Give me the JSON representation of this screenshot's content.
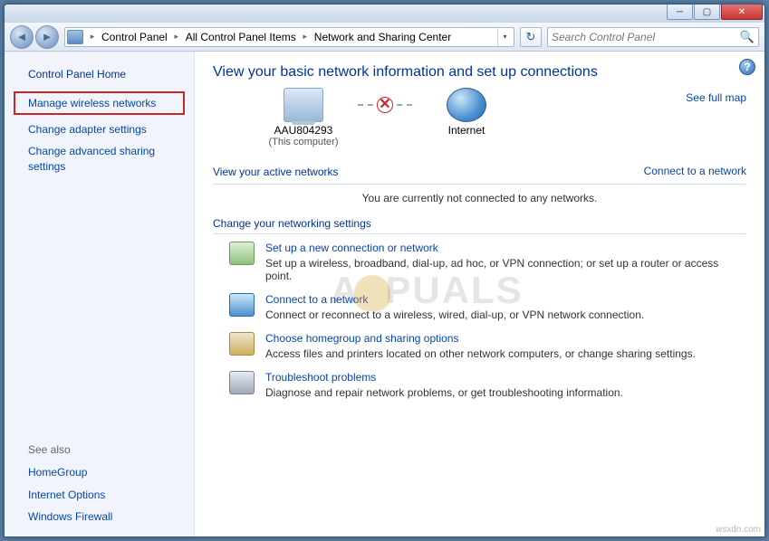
{
  "breadcrumbs": {
    "items": [
      "Control Panel",
      "All Control Panel Items",
      "Network and Sharing Center"
    ]
  },
  "search": {
    "placeholder": "Search Control Panel"
  },
  "sidebar": {
    "home": "Control Panel Home",
    "links": {
      "manage_wireless": "Manage wireless networks",
      "change_adapter": "Change adapter settings",
      "change_advanced": "Change advanced sharing settings"
    },
    "see_also_heading": "See also",
    "see_also": {
      "homegroup": "HomeGroup",
      "internet_options": "Internet Options",
      "windows_firewall": "Windows Firewall"
    }
  },
  "content": {
    "title": "View your basic network information and set up connections",
    "full_map": "See full map",
    "map": {
      "computer_name": "AAU804293",
      "computer_sub": "(This computer)",
      "internet_label": "Internet"
    },
    "active_heading": "View your active networks",
    "active_msg": "You are currently not connected to any networks.",
    "connect_link": "Connect to a network",
    "change_heading": "Change your networking settings",
    "tasks": {
      "setup": {
        "title": "Set up a new connection or network",
        "desc": "Set up a wireless, broadband, dial-up, ad hoc, or VPN connection; or set up a router or access point."
      },
      "connect": {
        "title": "Connect to a network",
        "desc": "Connect or reconnect to a wireless, wired, dial-up, or VPN network connection."
      },
      "homegroup": {
        "title": "Choose homegroup and sharing options",
        "desc": "Access files and printers located on other network computers, or change sharing settings."
      },
      "troubleshoot": {
        "title": "Troubleshoot problems",
        "desc": "Diagnose and repair network problems, or get troubleshooting information."
      }
    }
  },
  "watermark": {
    "left": "A",
    "right": "PUALS"
  },
  "corner": "wsxdn.com"
}
